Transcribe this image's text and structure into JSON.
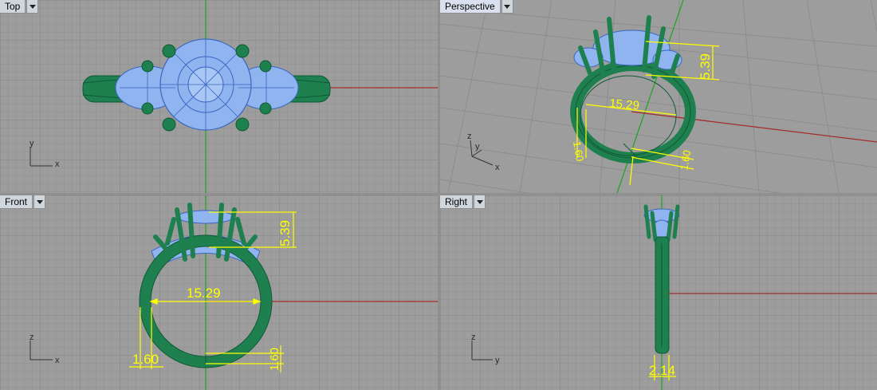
{
  "viewports": {
    "top": {
      "title": "Top",
      "axis_a": "y",
      "axis_b": "x"
    },
    "perspective": {
      "title": "Perspective",
      "axis_a": "z",
      "axis_b": "y",
      "axis_c": "x"
    },
    "front": {
      "title": "Front",
      "axis_a": "z",
      "axis_b": "x"
    },
    "right": {
      "title": "Right",
      "axis_a": "z",
      "axis_b": "y"
    }
  },
  "dimensions": {
    "head_height": "5.39",
    "inner_diameter": "15.29",
    "band_thickness": "1.60",
    "band_width": "2.14"
  },
  "colors": {
    "viewport_bg": "#9d9d9d",
    "grid_minor": "#8f8f8f",
    "grid_major": "#858585",
    "x_axis": "#a32d2d",
    "y_axis": "#27a227",
    "metal": "#1e7f4f",
    "metal_dark": "#0f5a34",
    "stone": "#8fb4f0",
    "dimension": "#ffff00"
  },
  "icons": {
    "viewport_menu": "triangle-down-icon",
    "world_axes": "axis-triad-icon"
  }
}
